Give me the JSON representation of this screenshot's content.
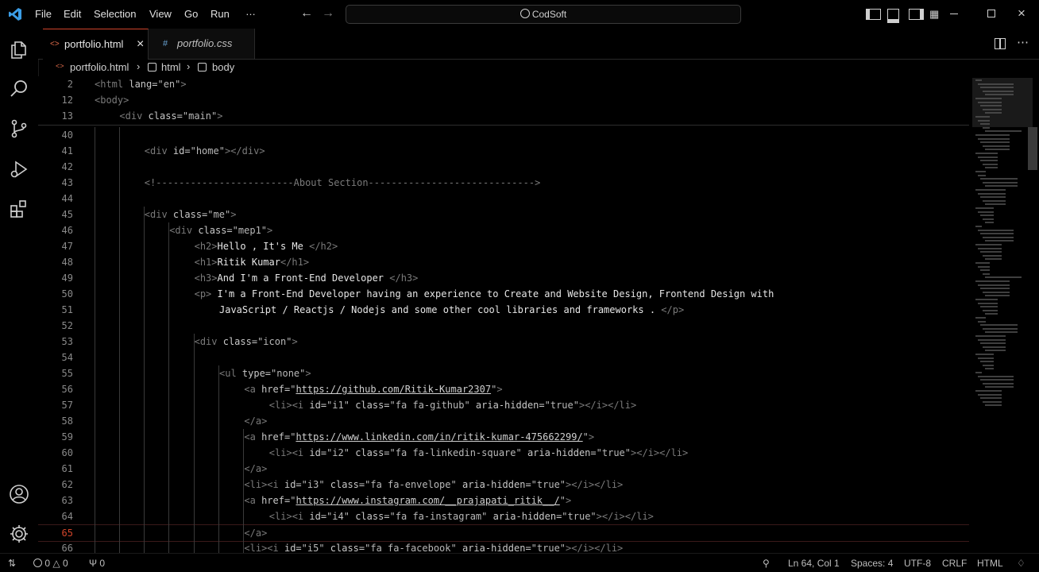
{
  "menu": [
    "File",
    "Edit",
    "Selection",
    "View",
    "Go",
    "Run",
    "…"
  ],
  "search": {
    "text": "CodSoft"
  },
  "tabs": [
    {
      "label": "portfolio.html",
      "active": true,
      "close": "×"
    },
    {
      "label": "portfolio.css",
      "active": false
    }
  ],
  "breadcrumb": {
    "file": "portfolio.html",
    "sep1": "›",
    "el1": "html",
    "sep2": "›",
    "el2": "body"
  },
  "sticky": [
    {
      "n": "2",
      "indent": 0,
      "parts": [
        [
          "tag",
          "<html "
        ],
        [
          "attr",
          "lang="
        ],
        [
          "val",
          "\"en\""
        ],
        [
          "tag",
          ">"
        ]
      ]
    },
    {
      "n": "12",
      "indent": 0,
      "parts": [
        [
          "tag",
          "<body>"
        ]
      ]
    },
    {
      "n": "13",
      "indent": 1,
      "parts": [
        [
          "tag",
          "<div "
        ],
        [
          "attr",
          "class="
        ],
        [
          "val",
          "\"main\""
        ],
        [
          "tag",
          ">"
        ]
      ]
    }
  ],
  "lines": [
    {
      "n": "40",
      "indent": 0,
      "parts": []
    },
    {
      "n": "41",
      "indent": 2,
      "parts": [
        [
          "tag",
          "<div "
        ],
        [
          "attr",
          "id="
        ],
        [
          "val",
          "\"home\""
        ],
        [
          "tag",
          "></div>"
        ]
      ]
    },
    {
      "n": "42",
      "indent": 0,
      "parts": []
    },
    {
      "n": "43",
      "indent": 2,
      "parts": [
        [
          "comment",
          "<!------------------------About Section----------------------------->"
        ]
      ]
    },
    {
      "n": "44",
      "indent": 0,
      "parts": []
    },
    {
      "n": "45",
      "indent": 2,
      "parts": [
        [
          "tag",
          "<div "
        ],
        [
          "attr",
          "class="
        ],
        [
          "val",
          "\"me\""
        ],
        [
          "tag",
          ">"
        ]
      ]
    },
    {
      "n": "46",
      "indent": 3,
      "parts": [
        [
          "tag",
          "<div "
        ],
        [
          "attr",
          "class="
        ],
        [
          "val",
          "\"mep1\""
        ],
        [
          "tag",
          ">"
        ]
      ]
    },
    {
      "n": "47",
      "indent": 4,
      "parts": [
        [
          "tag",
          "<h2>"
        ],
        [
          "txt",
          "Hello , It's Me "
        ],
        [
          "tag",
          "</h2>"
        ]
      ]
    },
    {
      "n": "48",
      "indent": 4,
      "parts": [
        [
          "tag",
          "<h1>"
        ],
        [
          "txt",
          "Ritik Kumar"
        ],
        [
          "tag",
          "</h1>"
        ]
      ]
    },
    {
      "n": "49",
      "indent": 4,
      "parts": [
        [
          "tag",
          "<h3>"
        ],
        [
          "txt",
          "And I'm a Front-End Developer "
        ],
        [
          "tag",
          "</h3>"
        ]
      ]
    },
    {
      "n": "50",
      "indent": 4,
      "parts": [
        [
          "tag",
          "<p> "
        ],
        [
          "txt",
          "I'm a Front-End Developer having an experience to Create and Website Design, Frontend Design with"
        ]
      ]
    },
    {
      "n": "51",
      "indent": 5,
      "parts": [
        [
          "txt",
          "JavaScript / Reactjs / Nodejs and some other cool libraries and frameworks . "
        ],
        [
          "tag",
          "</p>"
        ]
      ]
    },
    {
      "n": "52",
      "indent": 0,
      "parts": []
    },
    {
      "n": "53",
      "indent": 4,
      "parts": [
        [
          "tag",
          "<div "
        ],
        [
          "attr",
          "class="
        ],
        [
          "val",
          "\"icon\""
        ],
        [
          "tag",
          ">"
        ]
      ]
    },
    {
      "n": "54",
      "indent": 0,
      "parts": []
    },
    {
      "n": "55",
      "indent": 5,
      "parts": [
        [
          "tag",
          "<ul "
        ],
        [
          "attr",
          "type="
        ],
        [
          "val",
          "\"none\""
        ],
        [
          "tag",
          ">"
        ]
      ]
    },
    {
      "n": "56",
      "indent": 6,
      "parts": [
        [
          "tag",
          "<a "
        ],
        [
          "attr",
          "href="
        ],
        [
          "val",
          "\""
        ],
        [
          "link",
          "https://github.com/Ritik-Kumar2307"
        ],
        [
          "val",
          "\""
        ],
        [
          "tag",
          ">"
        ]
      ]
    },
    {
      "n": "57",
      "indent": 7,
      "parts": [
        [
          "tag",
          "<li><i "
        ],
        [
          "attr",
          "id="
        ],
        [
          "val",
          "\"i1\" "
        ],
        [
          "attr",
          "class="
        ],
        [
          "val",
          "\"fa fa-github\" "
        ],
        [
          "attr",
          "aria-hidden="
        ],
        [
          "val",
          "\"true\""
        ],
        [
          "tag",
          "></i></li>"
        ]
      ]
    },
    {
      "n": "58",
      "indent": 6,
      "parts": [
        [
          "tag",
          "</a>"
        ]
      ]
    },
    {
      "n": "59",
      "indent": 6,
      "parts": [
        [
          "tag",
          "<a "
        ],
        [
          "attr",
          "href="
        ],
        [
          "val",
          "\""
        ],
        [
          "link",
          "https://www.linkedin.com/in/ritik-kumar-475662299/"
        ],
        [
          "val",
          "\""
        ],
        [
          "tag",
          ">"
        ]
      ]
    },
    {
      "n": "60",
      "indent": 7,
      "parts": [
        [
          "tag",
          "<li><i "
        ],
        [
          "attr",
          "id="
        ],
        [
          "val",
          "\"i2\" "
        ],
        [
          "attr",
          "class="
        ],
        [
          "val",
          "\"fa fa-linkedin-square\" "
        ],
        [
          "attr",
          "aria-hidden="
        ],
        [
          "val",
          "\"true\""
        ],
        [
          "tag",
          "></i></li>"
        ]
      ]
    },
    {
      "n": "61",
      "indent": 6,
      "parts": [
        [
          "tag",
          "</a>"
        ]
      ]
    },
    {
      "n": "62",
      "indent": 6,
      "parts": [
        [
          "tag",
          "<li><i "
        ],
        [
          "attr",
          "id="
        ],
        [
          "val",
          "\"i3\" "
        ],
        [
          "attr",
          "class="
        ],
        [
          "val",
          "\"fa fa-envelope\" "
        ],
        [
          "attr",
          "aria-hidden="
        ],
        [
          "val",
          "\"true\""
        ],
        [
          "tag",
          "></i></li>"
        ]
      ]
    },
    {
      "n": "63",
      "indent": 6,
      "parts": [
        [
          "tag",
          "<a "
        ],
        [
          "attr",
          "href="
        ],
        [
          "val",
          "\""
        ],
        [
          "link",
          "https://www.instagram.com/__prajapati_ritik__/"
        ],
        [
          "val",
          "\""
        ],
        [
          "tag",
          ">"
        ]
      ]
    },
    {
      "n": "64",
      "indent": 7,
      "parts": [
        [
          "tag",
          "<li><i "
        ],
        [
          "attr",
          "id="
        ],
        [
          "val",
          "\"i4\" "
        ],
        [
          "attr",
          "class="
        ],
        [
          "val",
          "\"fa fa-instagram\" "
        ],
        [
          "attr",
          "aria-hidden="
        ],
        [
          "val",
          "\"true\""
        ],
        [
          "tag",
          "></i></li>"
        ]
      ]
    },
    {
      "n": "65",
      "indent": 6,
      "parts": [
        [
          "tag",
          "</a>"
        ]
      ],
      "current": true
    },
    {
      "n": "66",
      "indent": 6,
      "parts": [
        [
          "tag",
          "<li><i "
        ],
        [
          "attr",
          "id="
        ],
        [
          "val",
          "\"i5\" "
        ],
        [
          "attr",
          "class="
        ],
        [
          "val",
          "\"fa fa-facebook\" "
        ],
        [
          "attr",
          "aria-hidden="
        ],
        [
          "val",
          "\"true\""
        ],
        [
          "tag",
          "></i></li>"
        ]
      ]
    }
  ],
  "status": {
    "errors": "0",
    "warnings": "0",
    "ports": "0",
    "position": "Ln 64, Col 1",
    "spaces": "Spaces: 4",
    "encoding": "UTF-8",
    "eol": "CRLF",
    "language": "HTML"
  },
  "icons": [
    "vscode-logo-icon",
    "explorer-icon",
    "search-icon",
    "source-control-icon",
    "run-debug-icon",
    "extensions-icon",
    "account-icon",
    "settings-gear-icon"
  ]
}
